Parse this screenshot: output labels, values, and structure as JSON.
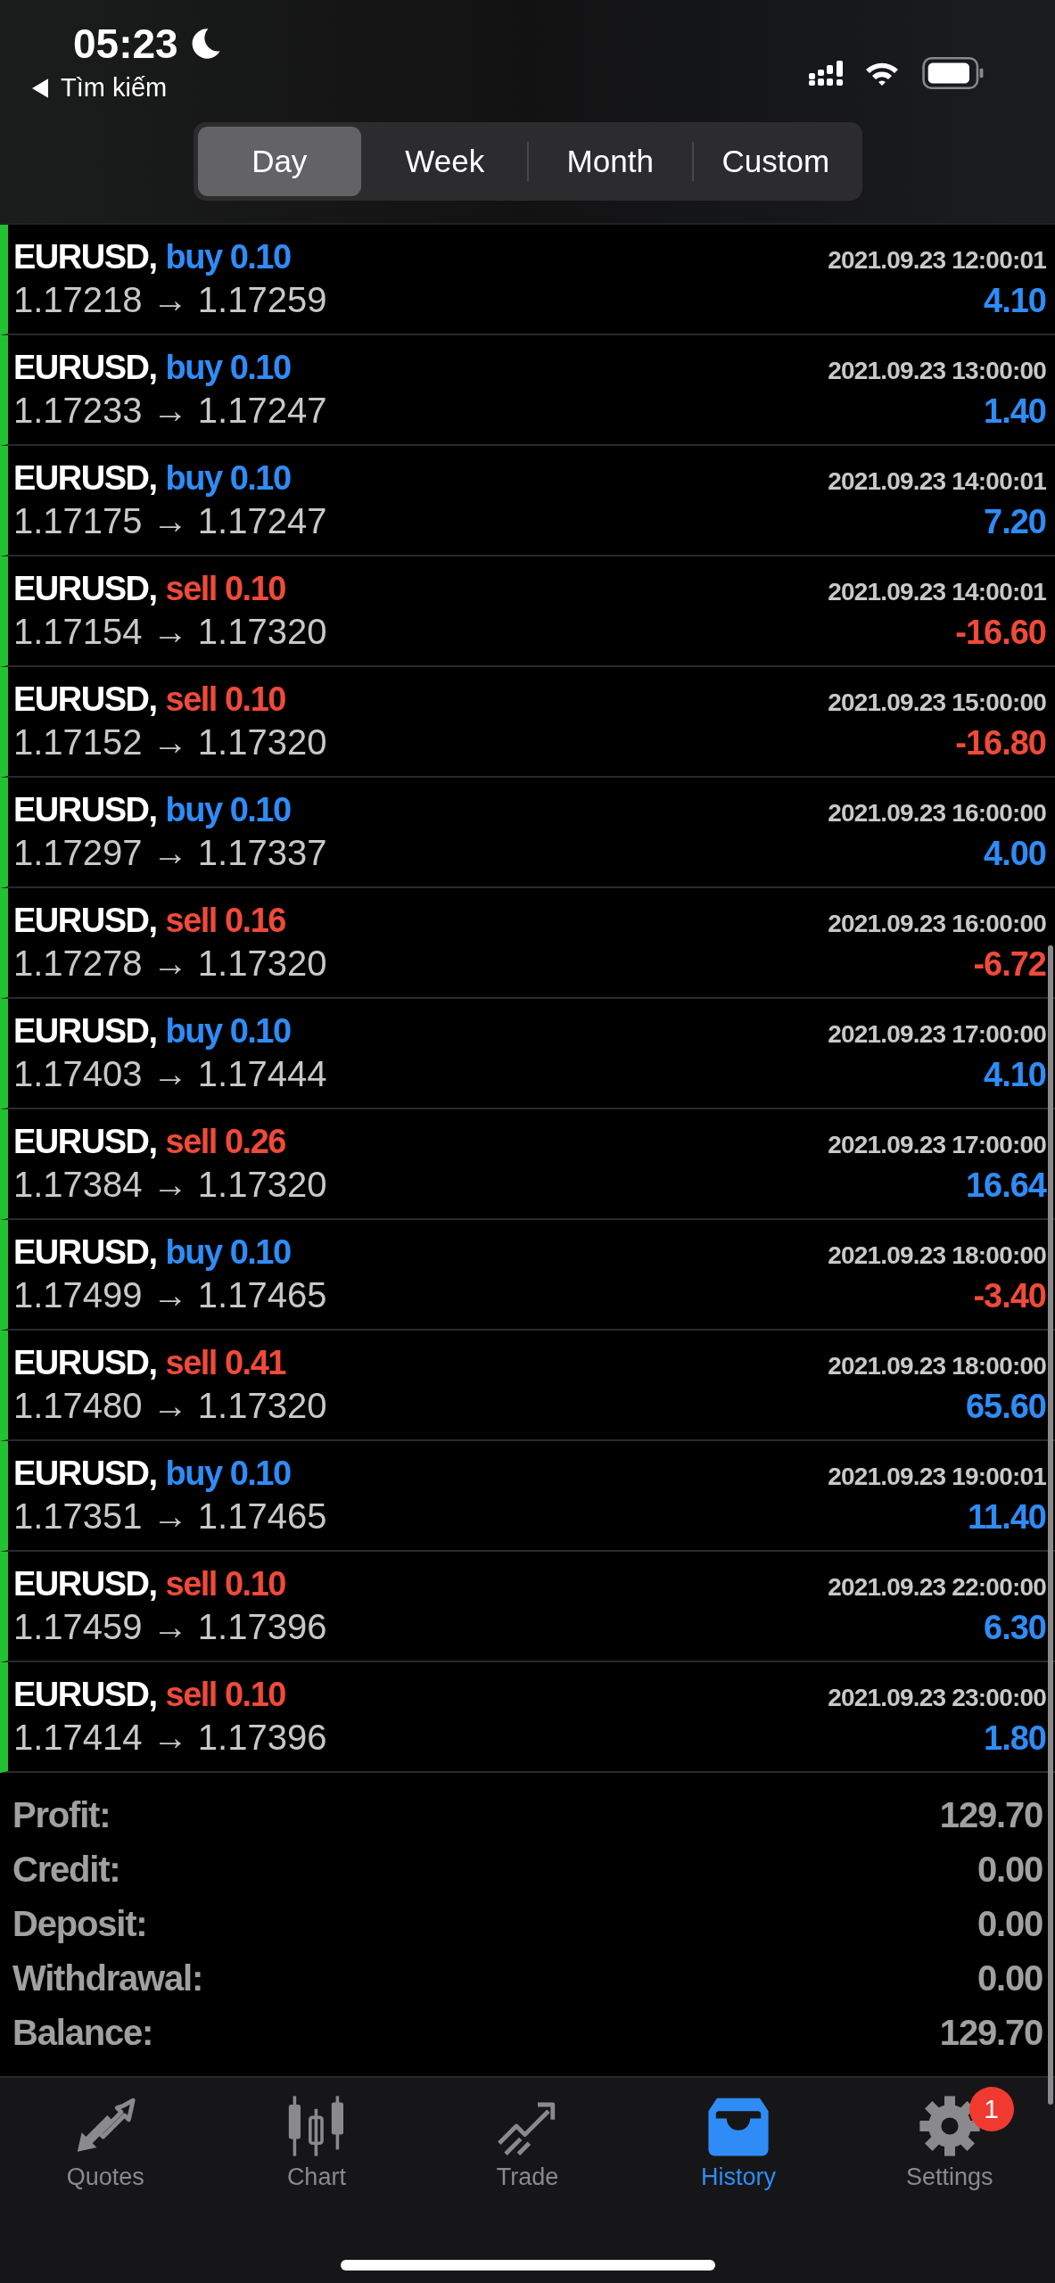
{
  "status_bar": {
    "time": "05:23",
    "back_label": "Tìm kiếm"
  },
  "period_tabs": [
    {
      "label": "Day",
      "selected": true
    },
    {
      "label": "Week",
      "selected": false
    },
    {
      "label": "Month",
      "selected": false
    },
    {
      "label": "Custom",
      "selected": false
    }
  ],
  "deals": [
    {
      "symbol": "EURUSD,",
      "kind": "buy",
      "volume": "buy 0.10",
      "time": "2021.09.23 12:00:01",
      "prices": "1.17218 → 1.17259",
      "profit": "4.10",
      "loss": false
    },
    {
      "symbol": "EURUSD,",
      "kind": "buy",
      "volume": "buy 0.10",
      "time": "2021.09.23 13:00:00",
      "prices": "1.17233 → 1.17247",
      "profit": "1.40",
      "loss": false
    },
    {
      "symbol": "EURUSD,",
      "kind": "buy",
      "volume": "buy 0.10",
      "time": "2021.09.23 14:00:01",
      "prices": "1.17175 → 1.17247",
      "profit": "7.20",
      "loss": false
    },
    {
      "symbol": "EURUSD,",
      "kind": "sell",
      "volume": "sell 0.10",
      "time": "2021.09.23 14:00:01",
      "prices": "1.17154 → 1.17320",
      "profit": "-16.60",
      "loss": true
    },
    {
      "symbol": "EURUSD,",
      "kind": "sell",
      "volume": "sell 0.10",
      "time": "2021.09.23 15:00:00",
      "prices": "1.17152 → 1.17320",
      "profit": "-16.80",
      "loss": true
    },
    {
      "symbol": "EURUSD,",
      "kind": "buy",
      "volume": "buy 0.10",
      "time": "2021.09.23 16:00:00",
      "prices": "1.17297 → 1.17337",
      "profit": "4.00",
      "loss": false
    },
    {
      "symbol": "EURUSD,",
      "kind": "sell",
      "volume": "sell 0.16",
      "time": "2021.09.23 16:00:00",
      "prices": "1.17278 → 1.17320",
      "profit": "-6.72",
      "loss": true
    },
    {
      "symbol": "EURUSD,",
      "kind": "buy",
      "volume": "buy 0.10",
      "time": "2021.09.23 17:00:00",
      "prices": "1.17403 → 1.17444",
      "profit": "4.10",
      "loss": false
    },
    {
      "symbol": "EURUSD,",
      "kind": "sell",
      "volume": "sell 0.26",
      "time": "2021.09.23 17:00:00",
      "prices": "1.17384 → 1.17320",
      "profit": "16.64",
      "loss": false
    },
    {
      "symbol": "EURUSD,",
      "kind": "buy",
      "volume": "buy 0.10",
      "time": "2021.09.23 18:00:00",
      "prices": "1.17499 → 1.17465",
      "profit": "-3.40",
      "loss": true
    },
    {
      "symbol": "EURUSD,",
      "kind": "sell",
      "volume": "sell 0.41",
      "time": "2021.09.23 18:00:00",
      "prices": "1.17480 → 1.17320",
      "profit": "65.60",
      "loss": false
    },
    {
      "symbol": "EURUSD,",
      "kind": "buy",
      "volume": "buy 0.10",
      "time": "2021.09.23 19:00:01",
      "prices": "1.17351 → 1.17465",
      "profit": "11.40",
      "loss": false
    },
    {
      "symbol": "EURUSD,",
      "kind": "sell",
      "volume": "sell 0.10",
      "time": "2021.09.23 22:00:00",
      "prices": "1.17459 → 1.17396",
      "profit": "6.30",
      "loss": false
    },
    {
      "symbol": "EURUSD,",
      "kind": "sell",
      "volume": "sell 0.10",
      "time": "2021.09.23 23:00:00",
      "prices": "1.17414 → 1.17396",
      "profit": "1.80",
      "loss": false
    }
  ],
  "summary": [
    {
      "label": "Profit:",
      "value": "129.70"
    },
    {
      "label": "Credit:",
      "value": "0.00"
    },
    {
      "label": "Deposit:",
      "value": "0.00"
    },
    {
      "label": "Withdrawal:",
      "value": "0.00"
    },
    {
      "label": "Balance:",
      "value": "129.70"
    }
  ],
  "tab_bar": [
    {
      "kind": "quotes",
      "label": "Quotes",
      "selected": false
    },
    {
      "kind": "chart",
      "label": "Chart",
      "selected": false
    },
    {
      "kind": "trade",
      "label": "Trade",
      "selected": false
    },
    {
      "kind": "history",
      "label": "History",
      "selected": true
    },
    {
      "kind": "settings",
      "label": "Settings",
      "selected": false,
      "badge": "1"
    }
  ]
}
